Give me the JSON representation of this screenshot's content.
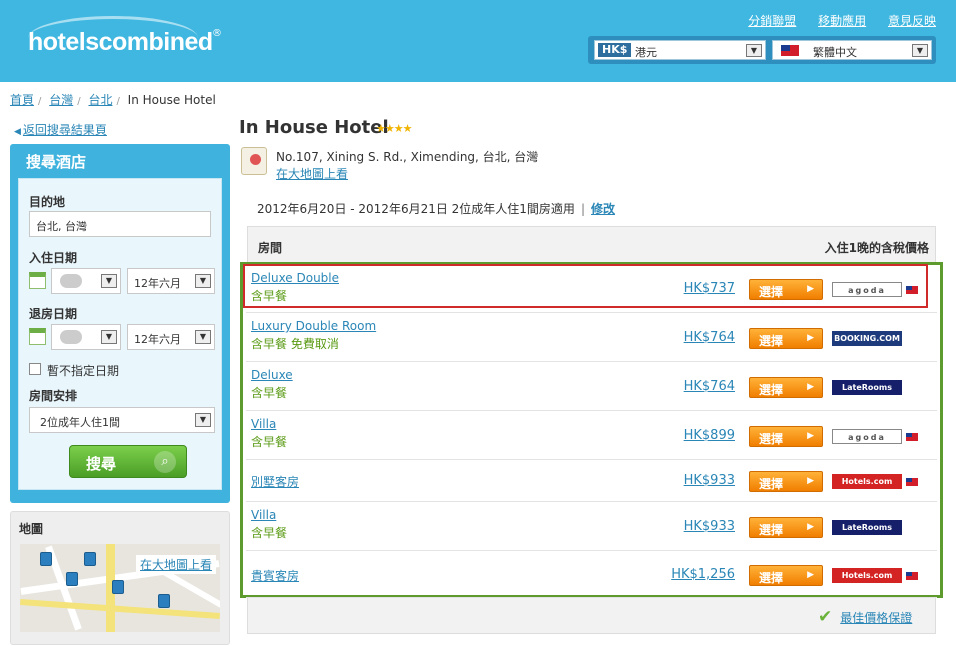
{
  "header": {
    "logo_text": "hotelscombined",
    "logo_mark": "®",
    "links": [
      "分銷聯盟",
      "移動應用",
      "意見反映"
    ],
    "currency": {
      "tag": "HK$",
      "value": "港元"
    },
    "language": {
      "value": "繁體中文"
    }
  },
  "breadcrumb": [
    "首頁",
    "台灣",
    "台北",
    "In House Hotel"
  ],
  "back_link": "返回搜尋結果頁",
  "search": {
    "title": "搜尋酒店",
    "destination_label": "目的地",
    "destination_value": "台北, 台灣",
    "checkin_label": "入住日期",
    "checkin_month": "12年六月",
    "checkout_label": "退房日期",
    "checkout_month": "12年六月",
    "no_dates_label": "暫不指定日期",
    "rooms_label": "房間安排",
    "rooms_value": "2位成年人住1間",
    "button_label": "搜尋"
  },
  "map_panel": {
    "title": "地圖",
    "link": "在大地圖上看"
  },
  "hotel": {
    "name": "In House Hotel",
    "stars": "★★★★",
    "address": "No.107, Xining S. Rd., Ximending, 台北, 台灣",
    "map_link": "在大地圖上看",
    "stay_text": "2012年6月20日 - 2012年6月21日 2位成年人住1間房適用",
    "stay_sep": "|",
    "modify_link": "修改"
  },
  "table": {
    "col_room": "房間",
    "col_price": "入住1晚的含稅價格",
    "select_label": "選擇",
    "rows": [
      {
        "name": "Deluxe Double",
        "sub": "含早餐",
        "price": "HK$737",
        "partner": "agoda",
        "partner_label": "agoda",
        "flag": true
      },
      {
        "name": "Luxury Double Room",
        "sub": "含早餐 免費取消",
        "price": "HK$764",
        "partner": "booking",
        "partner_label": "BOOKING.COM",
        "flag": false
      },
      {
        "name": "Deluxe",
        "sub": "含早餐",
        "price": "HK$764",
        "partner": "late",
        "partner_label": "LateRooms",
        "flag": false
      },
      {
        "name": "Villa",
        "sub": "含早餐",
        "price": "HK$899",
        "partner": "agoda",
        "partner_label": "agoda",
        "flag": true
      },
      {
        "name": "別墅客房",
        "sub": "",
        "price": "HK$933",
        "partner": "hotels",
        "partner_label": "Hotels.com",
        "flag": true
      },
      {
        "name": "Villa",
        "sub": "含早餐",
        "price": "HK$933",
        "partner": "late",
        "partner_label": "LateRooms",
        "flag": false
      },
      {
        "name": "貴賓客房",
        "sub": "",
        "price": "HK$1,256",
        "partner": "hotels",
        "partner_label": "Hotels.com",
        "flag": true
      }
    ]
  },
  "best_price_guarantee": "最佳價格保證",
  "colors": {
    "brand_blue": "#3fb7e0",
    "highlight_green": "#5e9b2e",
    "highlight_red": "#d12a2a",
    "select_orange": "#f07e00"
  }
}
